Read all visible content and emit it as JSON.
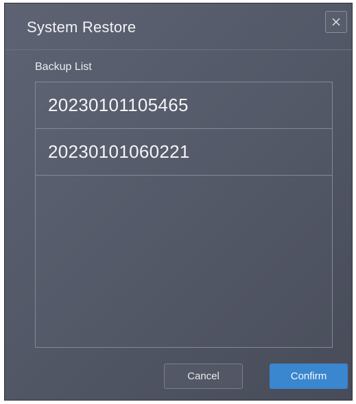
{
  "dialog": {
    "title": "System Restore",
    "close_icon": "close-icon"
  },
  "backup_list": {
    "label": "Backup List",
    "items": [
      {
        "name": "20230101105465"
      },
      {
        "name": "20230101060221"
      }
    ]
  },
  "footer": {
    "cancel_label": "Cancel",
    "confirm_label": "Confirm"
  },
  "colors": {
    "accent": "#3a86cf",
    "dialog_background": "#545a69",
    "border": "#858a96"
  }
}
